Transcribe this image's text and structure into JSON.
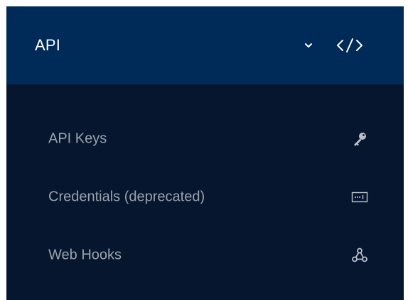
{
  "section": {
    "title": "API",
    "expand_icon": "chevron-down-icon",
    "section_icon": "code-icon"
  },
  "menu": {
    "items": [
      {
        "label": "API Keys",
        "icon": "key-icon"
      },
      {
        "label": "Credentials (deprecated)",
        "icon": "credentials-icon"
      },
      {
        "label": "Web Hooks",
        "icon": "webhook-icon"
      }
    ]
  },
  "colors": {
    "header_bg": "#002a57",
    "panel_bg": "#07162f",
    "header_text": "#ffffff",
    "item_text": "#9aa2ae",
    "icon_color": "#b9c0ca"
  }
}
